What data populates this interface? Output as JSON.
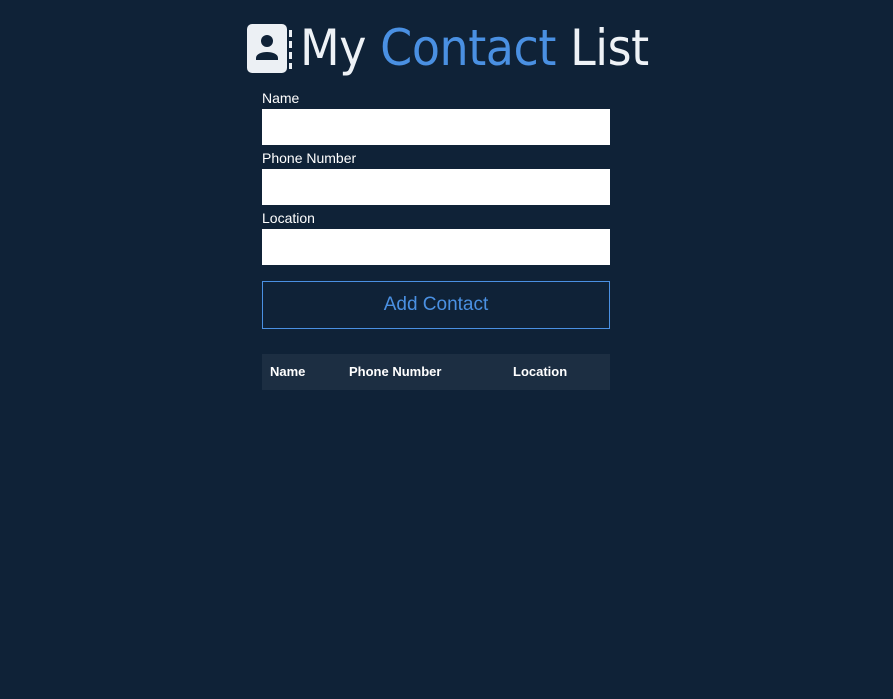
{
  "header": {
    "title_part1": "My",
    "title_part2": "Contact",
    "title_part3": "List",
    "icon": "address-book-icon"
  },
  "form": {
    "name_label": "Name",
    "name_value": "",
    "phone_label": "Phone Number",
    "phone_value": "",
    "location_label": "Location",
    "location_value": "",
    "submit_label": "Add Contact"
  },
  "table": {
    "columns": [
      "Name",
      "Phone Number",
      "Location"
    ],
    "rows": []
  },
  "colors": {
    "background": "#0f2237",
    "accent": "#4a90e2",
    "table_header": "#1c2e42"
  }
}
